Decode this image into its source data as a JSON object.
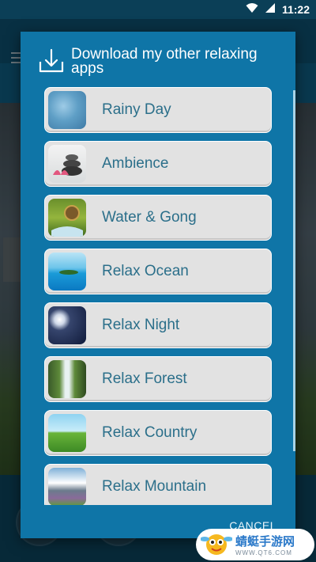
{
  "status_bar": {
    "time": "11:22"
  },
  "dialog": {
    "title": "Download my other relaxing apps",
    "icon": "download-icon",
    "items": [
      {
        "label": "Rainy Day",
        "thumb": "rainy"
      },
      {
        "label": "Ambience",
        "thumb": "amb"
      },
      {
        "label": "Water & Gong",
        "thumb": "water"
      },
      {
        "label": "Relax Ocean",
        "thumb": "ocean"
      },
      {
        "label": "Relax Night",
        "thumb": "night"
      },
      {
        "label": "Relax Forest",
        "thumb": "forest"
      },
      {
        "label": "Relax Country",
        "thumb": "country"
      },
      {
        "label": "Relax Mountain",
        "thumb": "mountain"
      }
    ],
    "cancel_label": "CANCEL"
  },
  "watermark": {
    "text": "蜻蜓手游网",
    "sub": "WWW.QT6.COM"
  },
  "colors": {
    "dialog_bg": "#0f75a7",
    "item_bg": "#e2e2e2",
    "item_text": "#2b6f8a"
  }
}
